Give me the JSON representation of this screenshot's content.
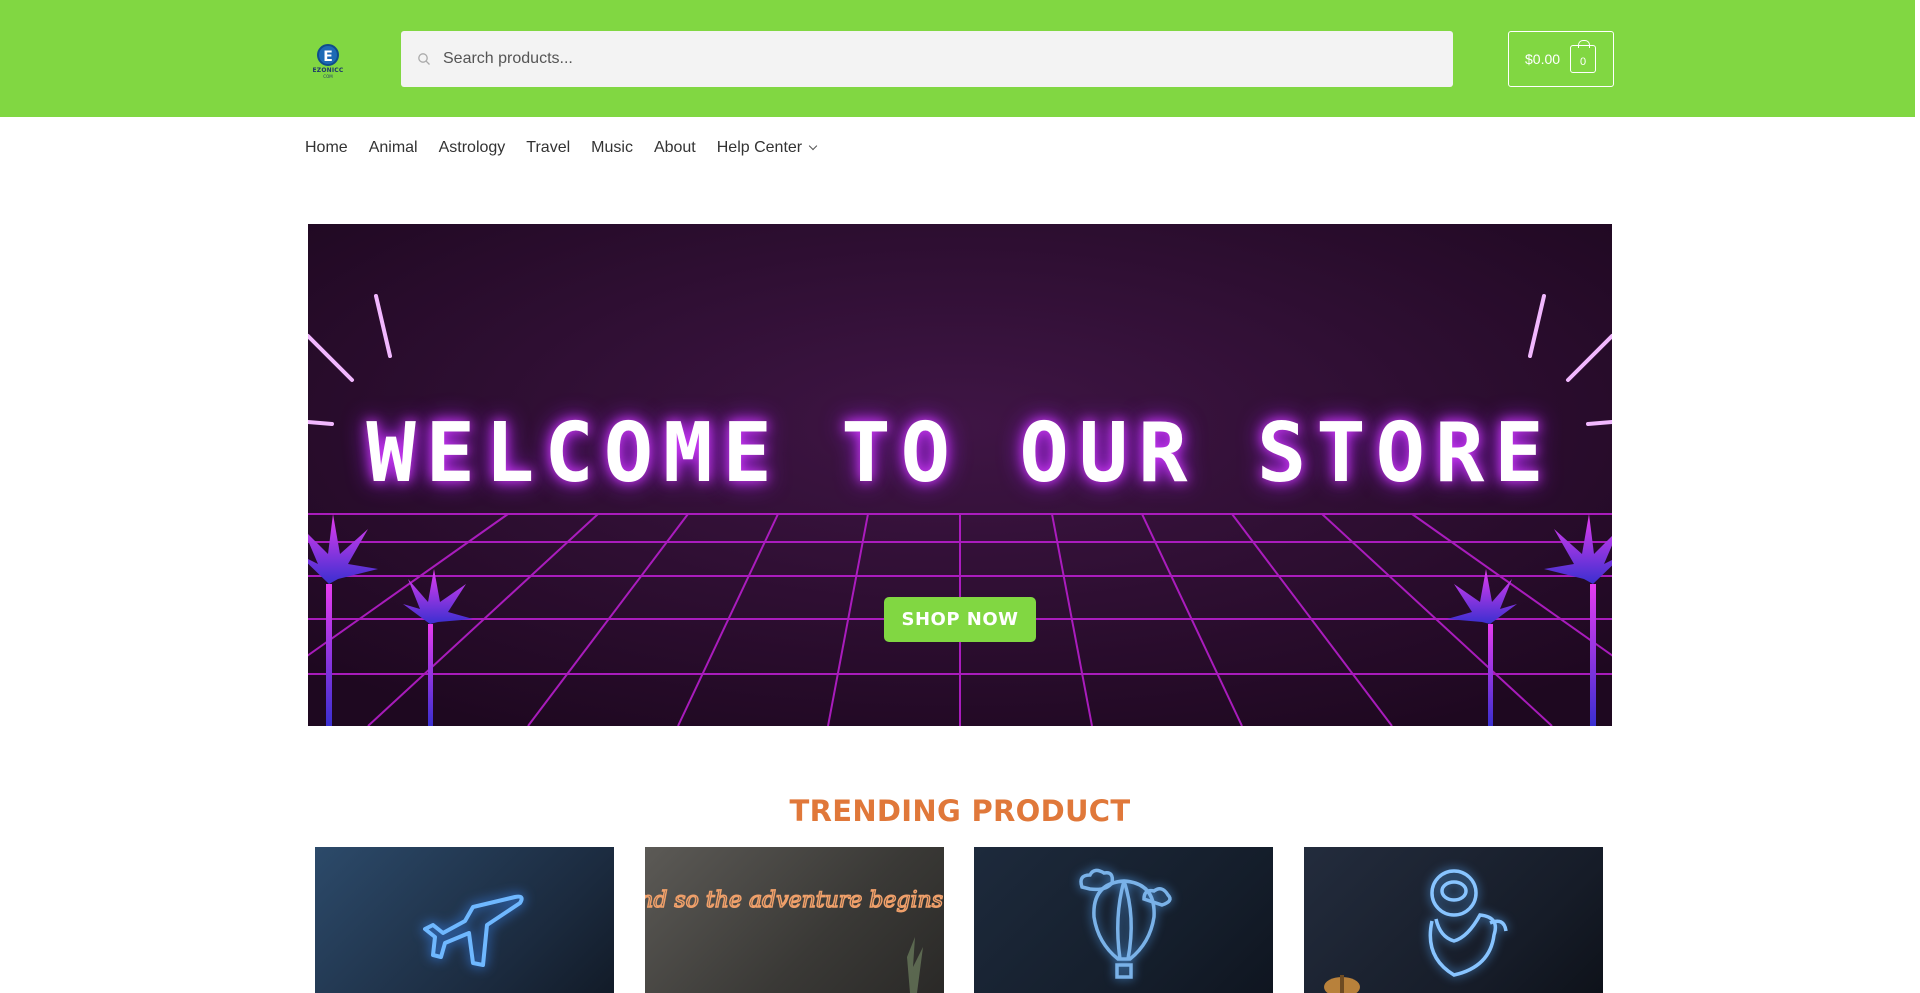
{
  "header": {
    "logo": {
      "mark": "E",
      "text": "EZONICC",
      "subtext": "COM"
    },
    "search": {
      "placeholder": "Search products..."
    },
    "cart": {
      "total": "$0.00",
      "count": "0"
    }
  },
  "nav": {
    "items": [
      {
        "label": "Home"
      },
      {
        "label": "Animal"
      },
      {
        "label": "Astrology"
      },
      {
        "label": "Travel"
      },
      {
        "label": "Music"
      },
      {
        "label": "About"
      },
      {
        "label": "Help Center"
      }
    ]
  },
  "hero": {
    "title": "WELCOME TO OUR STORE",
    "button_label": "SHOP NOW"
  },
  "trending": {
    "title": "TRENDING PRODUCT",
    "products": [
      {
        "icon": "airplane-neon-icon"
      },
      {
        "icon": "adventure-script-neon-icon",
        "text": "and so the adventure begins..."
      },
      {
        "icon": "hot-air-balloon-neon-icon"
      },
      {
        "icon": "astronaut-banana-neon-icon"
      }
    ]
  },
  "colors": {
    "brand_green": "#81d742",
    "accent_orange": "#e0783a",
    "hero_bg": "#2a0d2e",
    "neon_pink": "#d63cff"
  }
}
